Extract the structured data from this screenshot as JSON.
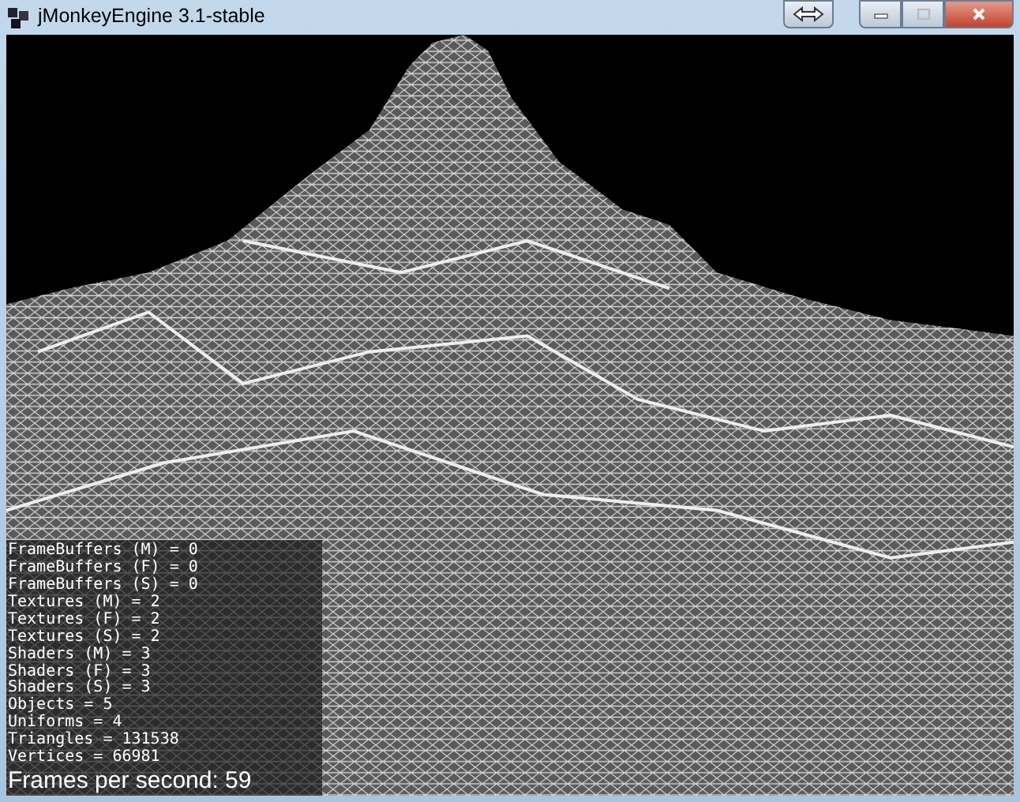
{
  "window": {
    "title": "jMonkeyEngine 3.1-stable"
  },
  "stats": [
    "FrameBuffers (M) = 0",
    "FrameBuffers (F) = 0",
    "FrameBuffers (S) = 0",
    "Textures (M) = 2",
    "Textures (F) = 2",
    "Textures (S) = 2",
    "Shaders (M) = 3",
    "Shaders (F) = 3",
    "Shaders (S) = 3",
    "Objects = 5",
    "Uniforms = 4",
    "Triangles = 131538",
    "Vertices = 66981"
  ],
  "fps": "Frames per second: 59"
}
